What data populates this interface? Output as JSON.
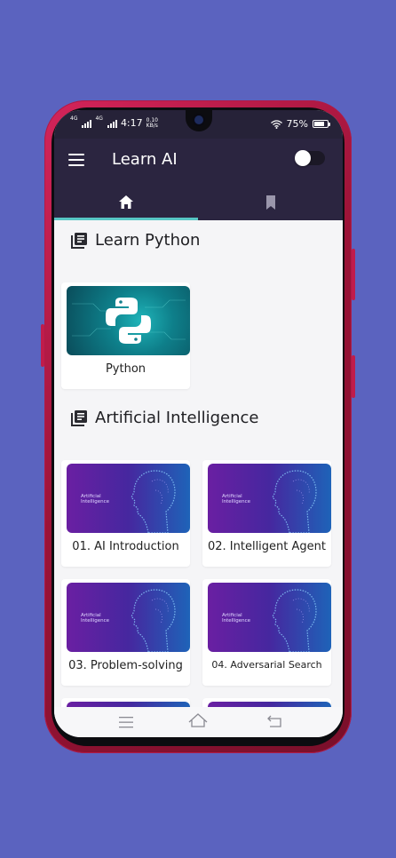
{
  "status_bar": {
    "signal1_label": "4G",
    "signal2_label": "4G",
    "time": "4:17",
    "speed_value": "0.10",
    "speed_unit": "KB/s",
    "battery": "75%",
    "battery_level": 0.75
  },
  "app_bar": {
    "title": "Learn AI",
    "menu_icon": "hamburger-icon",
    "theme_toggle_on": false
  },
  "tabs": [
    {
      "icon": "home-icon",
      "selected": true
    },
    {
      "icon": "bookmark-icon",
      "selected": false
    }
  ],
  "sections": [
    {
      "title": "Learn Python",
      "icon": "book-list-icon",
      "items": [
        {
          "label": "Python",
          "thumb": "python-logo"
        }
      ]
    },
    {
      "title": "Artificial Intelligence",
      "icon": "book-list-icon",
      "thumb_text": "Artificial\nIntelligence",
      "items": [
        {
          "label": "01. AI Introduction"
        },
        {
          "label": "02. Intelligent Agent"
        },
        {
          "label": "03. Problem-solving"
        },
        {
          "label": "04. Adversarial Search"
        }
      ]
    }
  ],
  "nav_bar": {
    "buttons": [
      "menu-icon",
      "home-icon",
      "back-icon"
    ]
  },
  "colors": {
    "background": "#5b63bf",
    "app_bar": "#2b2540",
    "tab_indicator": "#57c6c4",
    "phone_body": "#b01a47"
  }
}
